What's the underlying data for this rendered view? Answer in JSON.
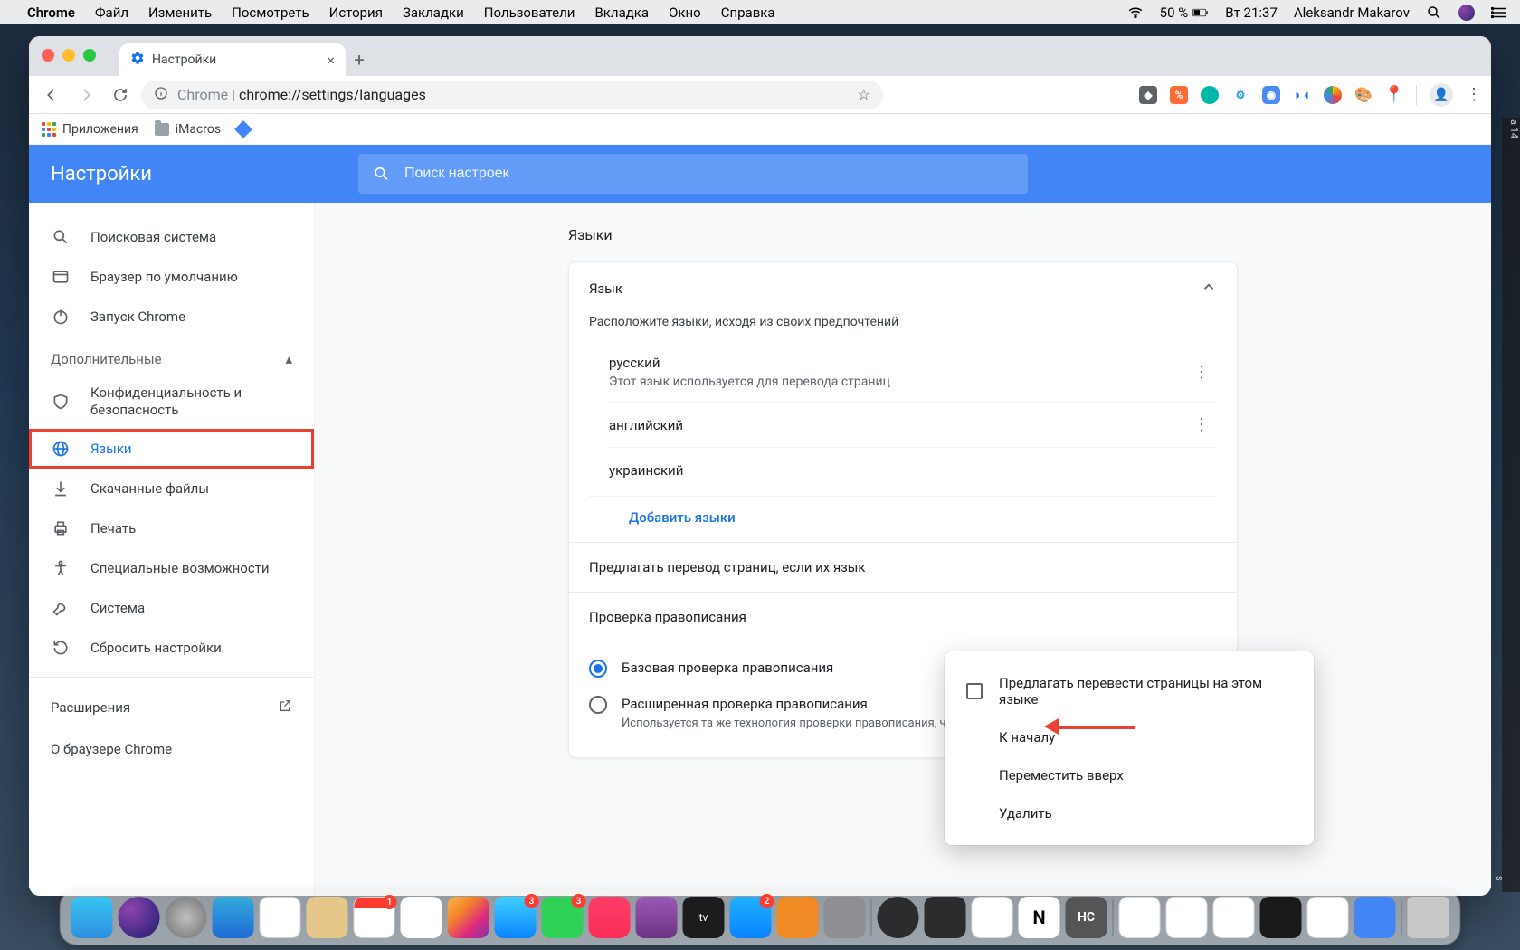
{
  "menubar": {
    "app": "Chrome",
    "items": [
      "Файл",
      "Изменить",
      "Посмотреть",
      "История",
      "Закладки",
      "Пользователи",
      "Вкладка",
      "Окно",
      "Справка"
    ],
    "battery": "50 %",
    "clock": "Вт 21:37",
    "user": "Aleksandr Makarov"
  },
  "tab": {
    "title": "Настройки"
  },
  "omnibox": {
    "prefix": "Chrome",
    "url": "chrome://settings/languages"
  },
  "bookmarks": {
    "apps": "Приложения",
    "imacros": "iMacros"
  },
  "settings_header": {
    "title": "Настройки",
    "search_placeholder": "Поиск настроек"
  },
  "nav": {
    "search_engine": "Поисковая система",
    "default_browser": "Браузер по умолчанию",
    "on_startup": "Запуск Chrome",
    "advanced": "Дополнительные",
    "privacy": "Конфиденциальность и безопасность",
    "languages": "Языки",
    "downloads": "Скачанные файлы",
    "printing": "Печать",
    "accessibility": "Специальные возможности",
    "system": "Система",
    "reset": "Сбросить настройки",
    "extensions": "Расширения",
    "about": "О браузере Chrome"
  },
  "page": {
    "section": "Языки",
    "card_title": "Язык",
    "hint": "Расположите языки, исходя из своих предпочтений",
    "langs": {
      "russian": "русский",
      "russian_sub": "Этот язык используется для перевода страниц",
      "english": "английский",
      "ukrainian": "украинский"
    },
    "add": "Добавить языки",
    "translate_row": "Предлагать перевод страниц, если их язык",
    "spell_title": "Проверка правописания",
    "spell_basic": "Базовая проверка правописания",
    "spell_enh": "Расширенная проверка правописания",
    "spell_enh_sub": "Используется та же технология проверки правописания, что и в Google"
  },
  "popup": {
    "offer_translate": "Предлагать перевести страницы на этом языке",
    "to_top": "К началу",
    "move_up": "Переместить вверх",
    "remove": "Удалить"
  },
  "right_peek": {
    "p1": "а\n14",
    "p2": "s"
  },
  "dock_badges": {
    "finder": null,
    "calendar": "1",
    "mail": "3",
    "messages": "3",
    "appstore": "2",
    "music": null
  }
}
